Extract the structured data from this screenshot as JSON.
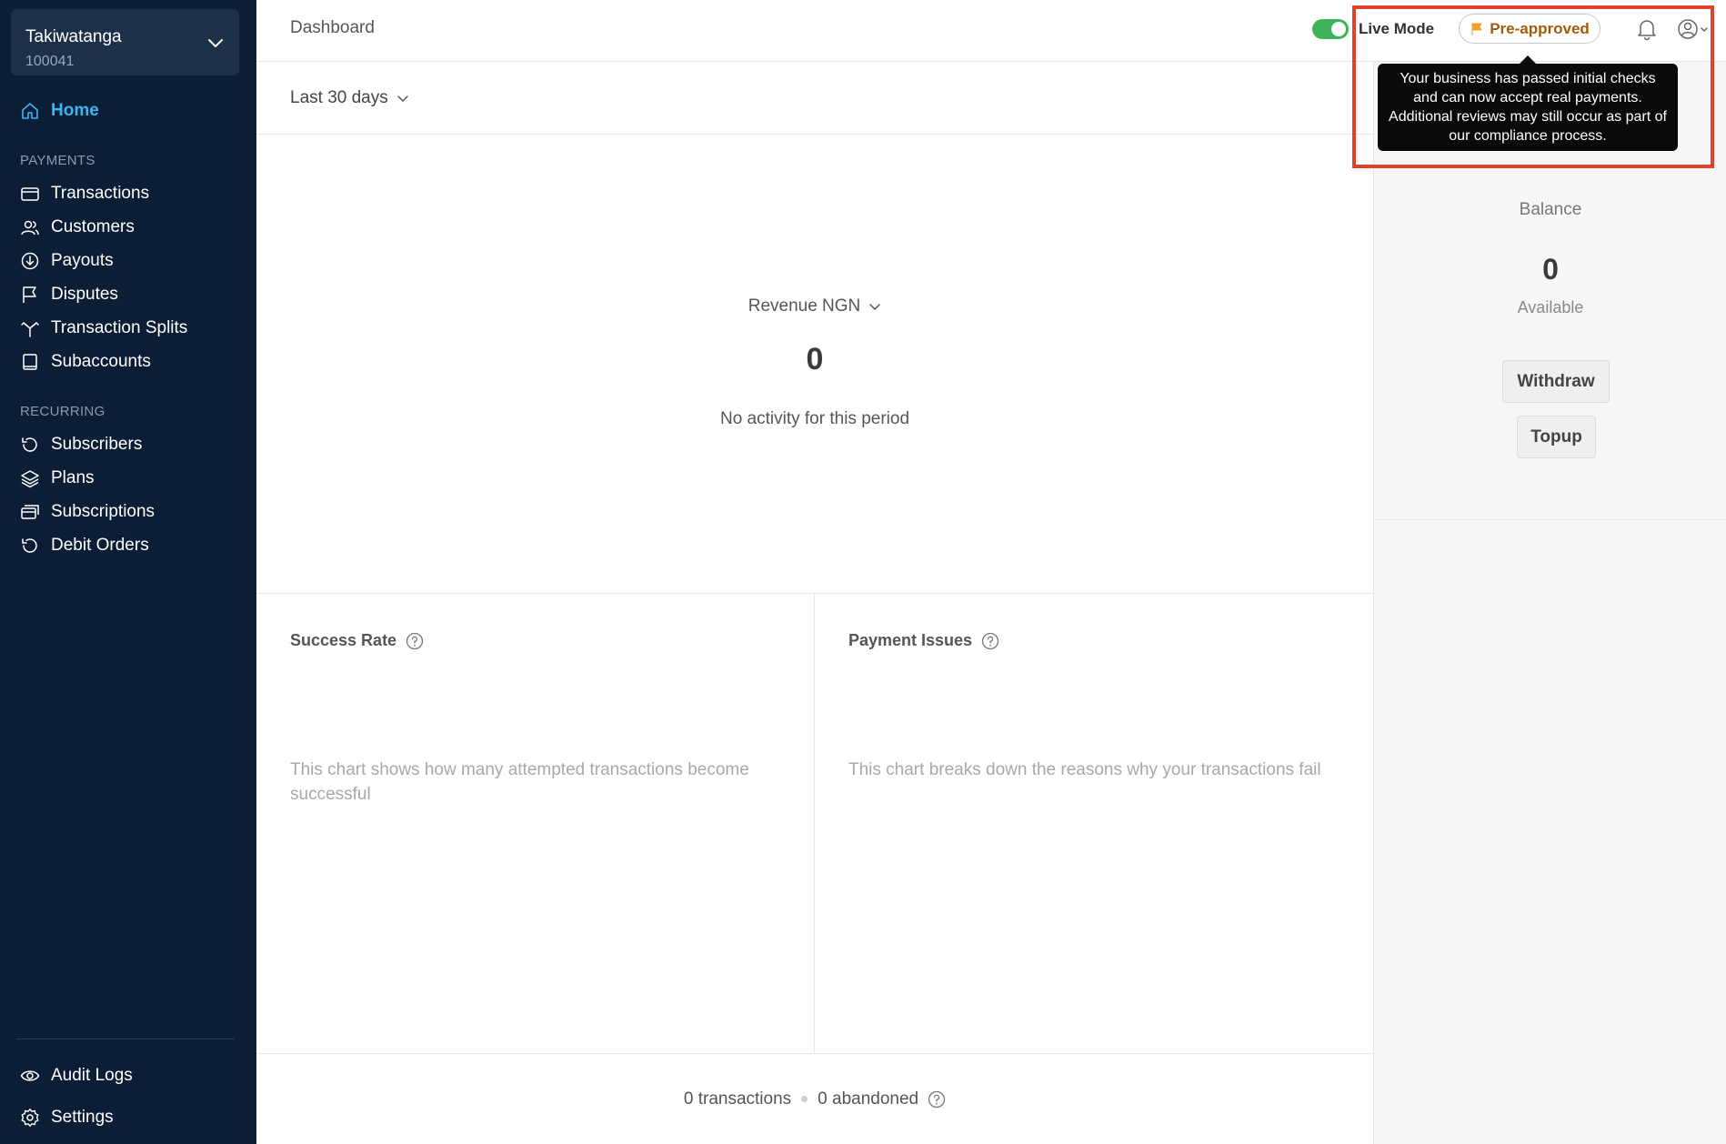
{
  "sidebar": {
    "business": {
      "name": "Takiwatanga",
      "id": "100041"
    },
    "home": "Home",
    "payments_section": "PAYMENTS",
    "payments": [
      "Transactions",
      "Customers",
      "Payouts",
      "Disputes",
      "Transaction Splits",
      "Subaccounts"
    ],
    "recurring_section": "RECURRING",
    "recurring": [
      "Subscribers",
      "Plans",
      "Subscriptions",
      "Debit Orders"
    ],
    "bottom": [
      "Audit Logs",
      "Settings"
    ]
  },
  "header": {
    "title": "Dashboard",
    "live_mode_label": "Live Mode",
    "live_mode_on": true,
    "status_badge": "Pre-approved",
    "tooltip": "Your business has passed initial checks and can now accept real payments. Additional reviews may still occur as part of our compliance process."
  },
  "filters": {
    "period": "Last 30 days"
  },
  "revenue": {
    "selector": "Revenue NGN",
    "value": "0",
    "empty_message": "No activity for this period"
  },
  "success_rate": {
    "title": "Success Rate",
    "description": "This chart shows how many attempted transactions become successful"
  },
  "payment_issues": {
    "title": "Payment Issues",
    "description": "This chart breaks down the reasons why your transactions fail"
  },
  "footer": {
    "transactions": "0 transactions",
    "abandoned": "0 abandoned"
  },
  "balance": {
    "title": "Balance",
    "value": "0",
    "sub": "Available",
    "withdraw": "Withdraw",
    "topup": "Topup"
  },
  "colors": {
    "sidebar_bg": "#0b1e36",
    "active_nav": "#3bb6f0",
    "toggle_on": "#3db35c",
    "badge_text": "#a35c0d",
    "highlight": "#e2412a"
  }
}
